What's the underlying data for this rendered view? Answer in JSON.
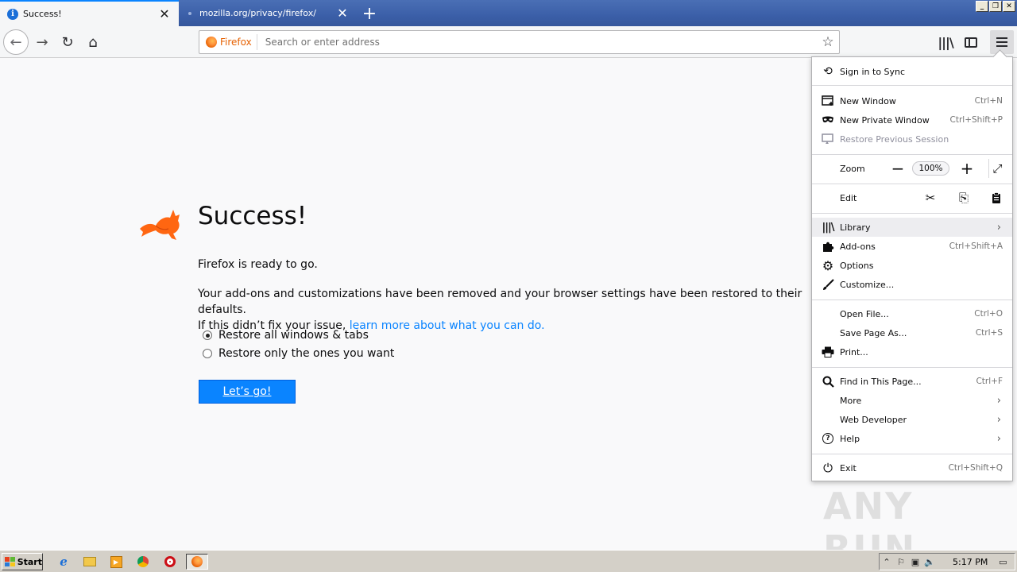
{
  "tabs": [
    {
      "title": "Success!",
      "active": true,
      "close_glyph": "✕"
    },
    {
      "title": "mozilla.org/privacy/firefox/",
      "active": false,
      "close_glyph": "✕"
    }
  ],
  "new_tab_glyph": "+",
  "window_controls": {
    "minimize": "_",
    "restore": "❐",
    "close": "✕"
  },
  "navbar": {
    "back_glyph": "←",
    "forward_glyph": "→",
    "reload_glyph": "↻",
    "home_glyph": "⌂",
    "identity_label": "Firefox",
    "url_placeholder": "Search or enter address",
    "url_value": "",
    "bookmark_glyph": "☆",
    "library_glyph": "|||\\"
  },
  "page": {
    "heading": "Success!",
    "ready_text": "Firefox is ready to go.",
    "removed_text": "Your add-ons and customizations have been removed and your browser settings have been restored to their defaults.",
    "fix_prefix": "If this didn’t fix your issue, ",
    "learn_more": "learn more about what you can do.",
    "radio_all": "Restore all windows & tabs",
    "radio_some": "Restore only the ones you want",
    "radio_selected": "all",
    "button": "Let’s go!"
  },
  "appmenu": {
    "sign_in": {
      "label": "Sign in to Sync",
      "icon": "⟲"
    },
    "new_window": {
      "label": "New Window",
      "shortcut": "Ctrl+N",
      "icon": "new-window-icon"
    },
    "new_private": {
      "label": "New Private Window",
      "shortcut": "Ctrl+Shift+P",
      "icon": "mask-icon"
    },
    "restore_session": {
      "label": "Restore Previous Session",
      "icon": "restore-icon"
    },
    "zoom": {
      "label": "Zoom",
      "minus": "−",
      "value": "100%",
      "plus": "+",
      "fullscreen": "⤢"
    },
    "edit": {
      "label": "Edit",
      "cut": "✂",
      "copy": "⎘",
      "paste": "📋"
    },
    "library": {
      "label": "Library",
      "arrow": "›"
    },
    "addons": {
      "label": "Add-ons",
      "shortcut": "Ctrl+Shift+A",
      "icon": "puzzle-icon"
    },
    "options": {
      "label": "Options",
      "icon": "⚙"
    },
    "customize": {
      "label": "Customize...",
      "icon": "brush-icon"
    },
    "open_file": {
      "label": "Open File...",
      "shortcut": "Ctrl+O"
    },
    "save_page": {
      "label": "Save Page As...",
      "shortcut": "Ctrl+S"
    },
    "print": {
      "label": "Print...",
      "icon": "printer-icon"
    },
    "find": {
      "label": "Find in This Page...",
      "shortcut": "Ctrl+F",
      "icon": "magnifier-icon"
    },
    "more": {
      "label": "More",
      "arrow": "›"
    },
    "web_developer": {
      "label": "Web Developer",
      "arrow": "›"
    },
    "help": {
      "label": "Help",
      "arrow": "›",
      "icon": "?"
    },
    "exit": {
      "label": "Exit",
      "shortcut": "Ctrl+Shift+Q",
      "icon": "⏻"
    }
  },
  "watermark": "ANY RUN",
  "taskbar": {
    "start_label": "Start",
    "clock": "5:17 PM",
    "apps": [
      "ie-icon",
      "folder-icon",
      "media-player-icon",
      "chrome-icon",
      "opera-icon",
      "firefox-icon"
    ]
  },
  "colors": {
    "accent": "#0a84ff",
    "firefox_orange": "#e66000",
    "tab_bar": "#3b5fa8"
  }
}
